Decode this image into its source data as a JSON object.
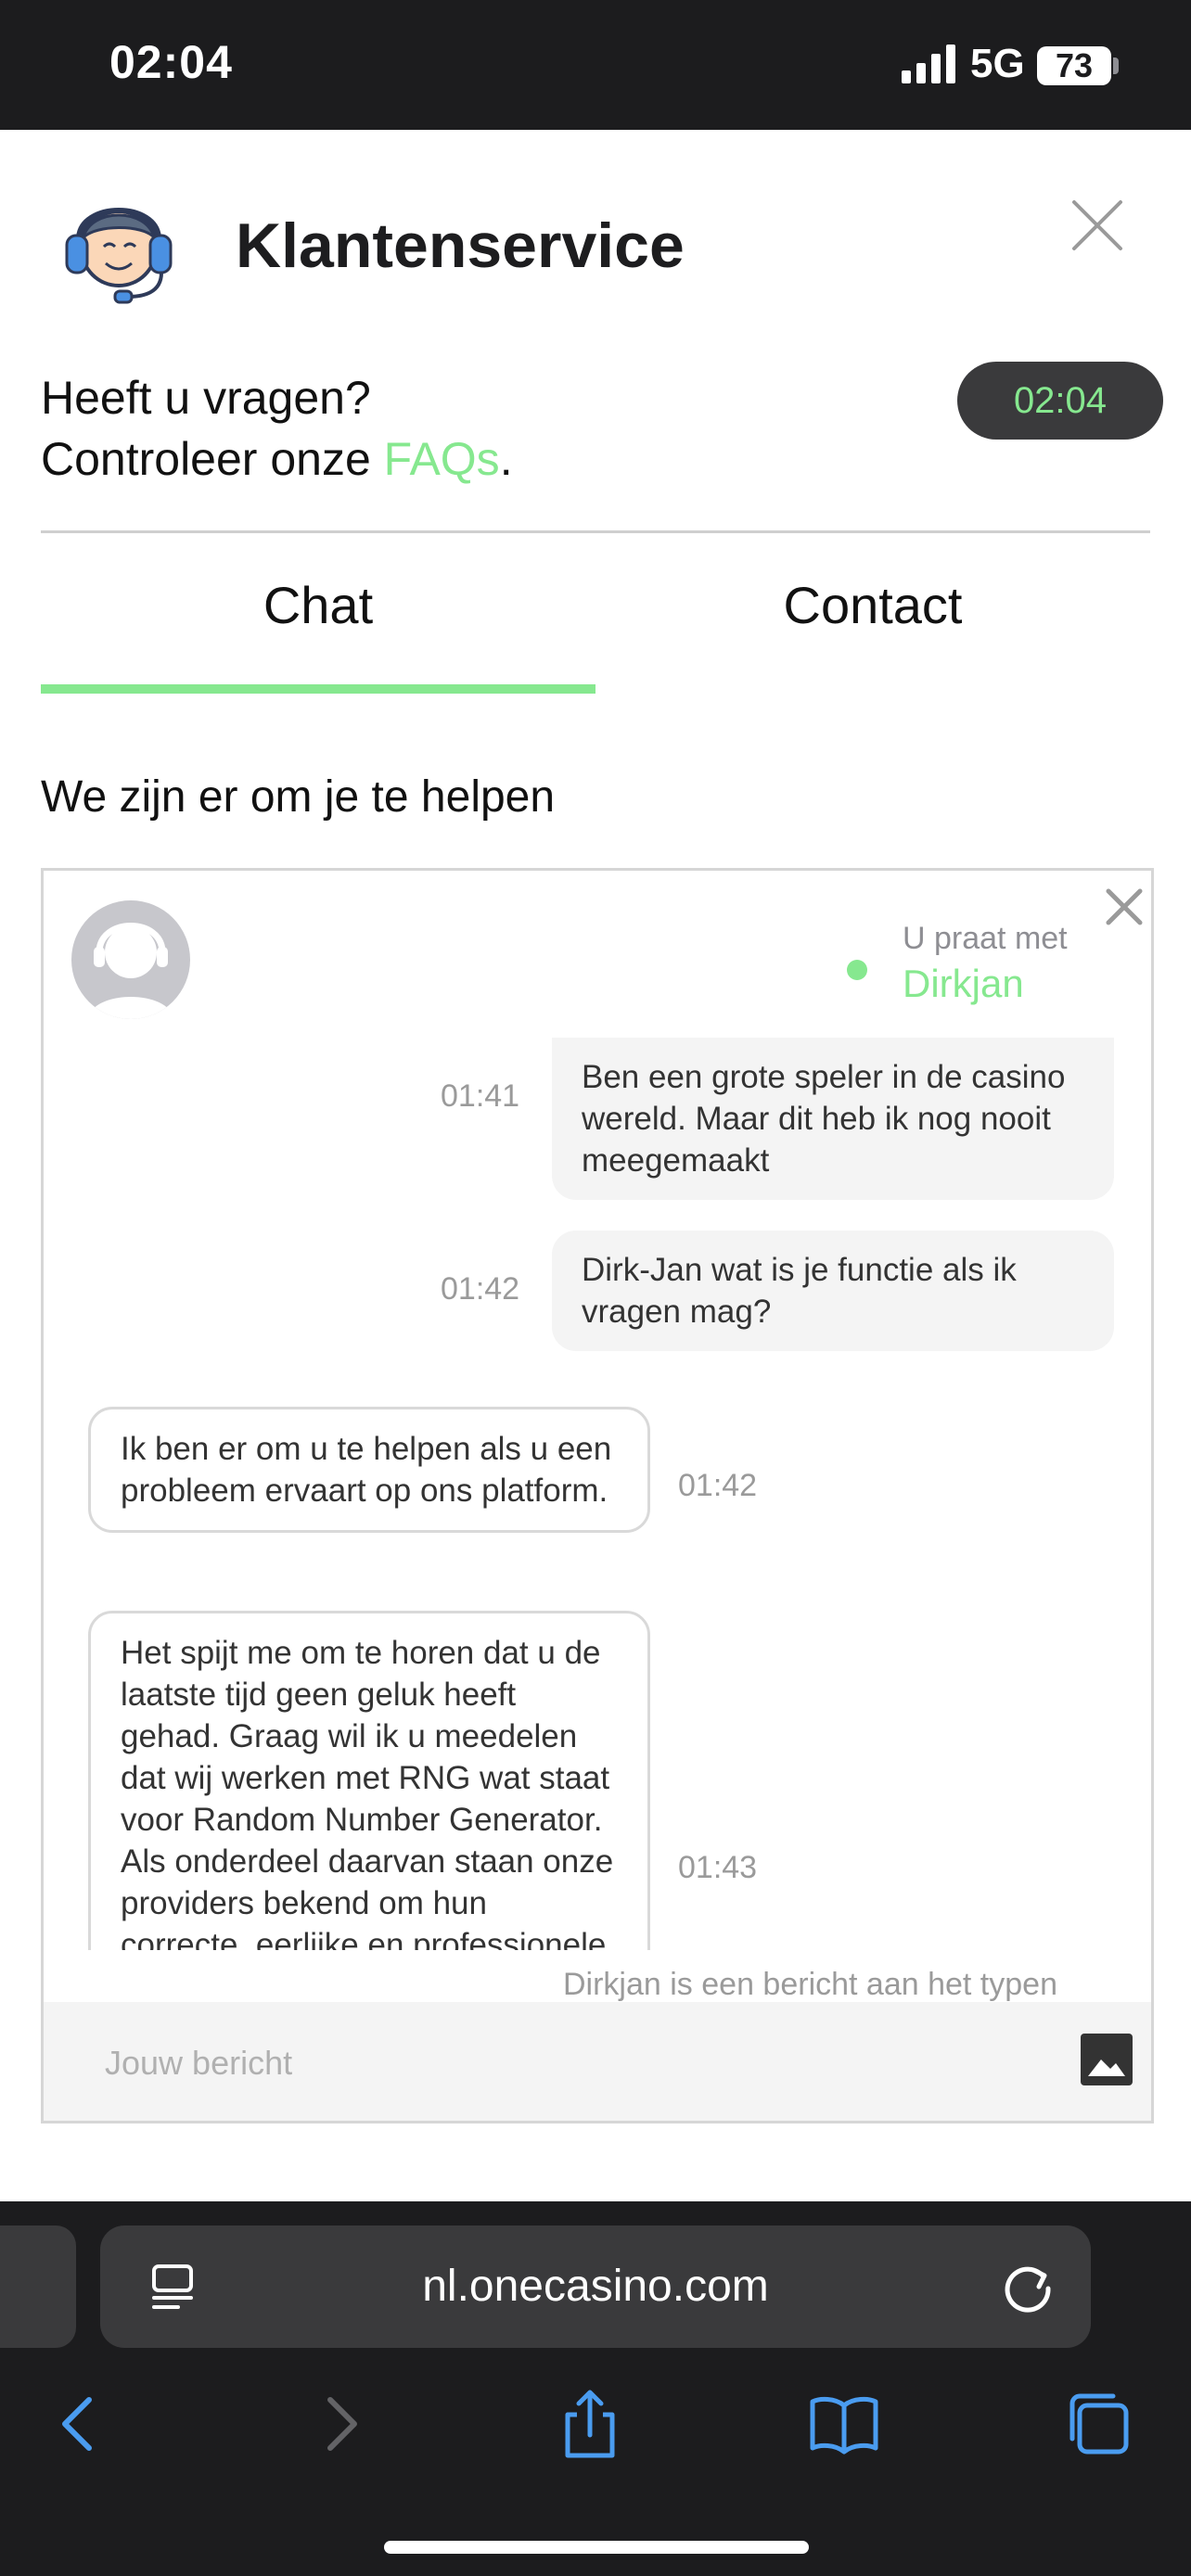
{
  "status_bar": {
    "time": "02:04",
    "network": "5G",
    "battery": "73"
  },
  "header": {
    "title": "Klantenservice"
  },
  "faq": {
    "line1": "Heeft u vragen?",
    "line2_prefix": "Controleer onze ",
    "link": "FAQs",
    "line2_suffix": "."
  },
  "timer": "02:04",
  "tabs": [
    {
      "label": "Chat",
      "active": true
    },
    {
      "label": "Contact",
      "active": false
    }
  ],
  "help_heading": "We zijn er om je te helpen",
  "chat": {
    "talking_with_label": "U praat met",
    "agent_name": "Dirkjan",
    "messages": [
      {
        "from": "user",
        "text": "Ben een grote speler in de casino wereld. Maar dit heb ik nog nooit meegemaakt",
        "time": "01:41"
      },
      {
        "from": "user",
        "text": "Dirk-Jan wat is je functie als ik vragen mag?",
        "time": "01:42"
      },
      {
        "from": "agent",
        "text": "Ik ben er om u te helpen als u een probleem ervaart op ons platform.",
        "time": "01:42"
      },
      {
        "from": "agent",
        "text": "Het spijt me om te horen dat u de laatste tijd geen geluk heeft gehad. Graag wil ik u meedelen dat wij werken met RNG wat staat voor Random Number Generator. Als onderdeel daarvan staan onze providers bekend om hun correcte, eerlijke en professionele manier van werken. Ik hoop dat",
        "time": "01:43"
      }
    ],
    "typing": "Dirkjan is een bericht aan het typen",
    "input_placeholder": "Jouw bericht"
  },
  "browser": {
    "url": "nl.onecasino.com"
  },
  "colors": {
    "accent": "#86e88f",
    "dark": "#1c1c1e"
  }
}
